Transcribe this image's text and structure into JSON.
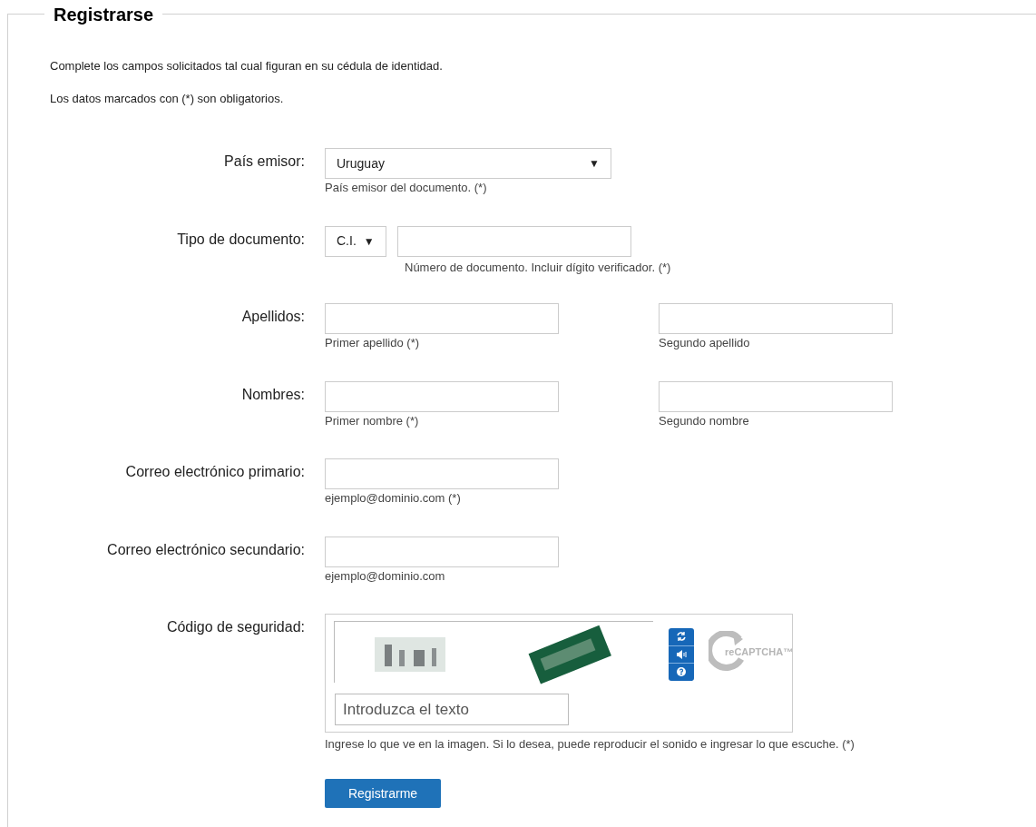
{
  "title": "Registrarse",
  "intro": [
    "Complete los campos solicitados tal cual figuran en su cédula de identidad.",
    "Los datos marcados con (*) son obligatorios."
  ],
  "rows": [
    {
      "kind": "select",
      "label": "País emisor:",
      "value": "Uruguay",
      "arrow": "▼",
      "hint": "País emisor del documento. (*)"
    },
    {
      "kind": "document",
      "label": "Tipo de documento:",
      "value": "C.I.",
      "arrow": "▼",
      "hint": "Número de documento. Incluir dígito verificador. (*)"
    },
    {
      "kind": "pair",
      "label": "Apellidos:",
      "hints": [
        "Primer apellido (*)",
        "Segundo apellido"
      ]
    },
    {
      "kind": "pair",
      "label": "Nombres:",
      "hints": [
        "Primer nombre (*)",
        "Segundo nombre"
      ]
    },
    {
      "kind": "single",
      "label": "Correo electrónico primario:",
      "hint": "ejemplo@dominio.com (*)"
    },
    {
      "kind": "single",
      "label": "Correo electrónico secundario:",
      "hint": "ejemplo@dominio.com"
    },
    {
      "kind": "captcha",
      "label": "Código de seguridad:",
      "placeholder": "Introduzca el texto",
      "logo": "reCAPTCHA™",
      "hint": "Ingrese lo que ve en la imagen. Si lo desea, puede reproducir el sonido e ingresar lo que escuche. (*)"
    }
  ],
  "submit": "Registrarme"
}
